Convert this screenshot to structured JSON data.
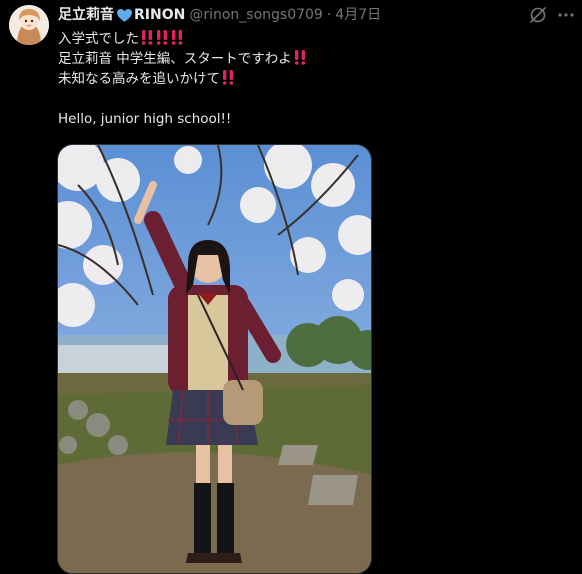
{
  "tweet": {
    "author": {
      "display_name": "足立莉音",
      "name_suffix": "RINON",
      "handle": "@rinon_songs0709",
      "verified_heart_color": "#1d9bf0"
    },
    "separator": "·",
    "date": "4月7日",
    "lines": [
      {
        "text": "入学式でした",
        "bangs": 3
      },
      {
        "text": "足立莉音 中学生編、スタートですわよ",
        "bangs": 1
      },
      {
        "text": "未知なる高みを追いかけて",
        "bangs": 1
      },
      {
        "text": "",
        "bangs": 0
      },
      {
        "text": "Hello, junior high school!!",
        "bangs": 0
      }
    ],
    "media": {
      "kind": "photo"
    },
    "icons": {
      "grok": "grok-icon",
      "more": "more-icon",
      "bang": "double-exclamation-emoji",
      "heart": "blue-heart-emoji"
    }
  },
  "colors": {
    "background": "#000000",
    "text_primary": "#e7e9ea",
    "text_secondary": "#71767b",
    "emoji_red": "#e0245e"
  }
}
